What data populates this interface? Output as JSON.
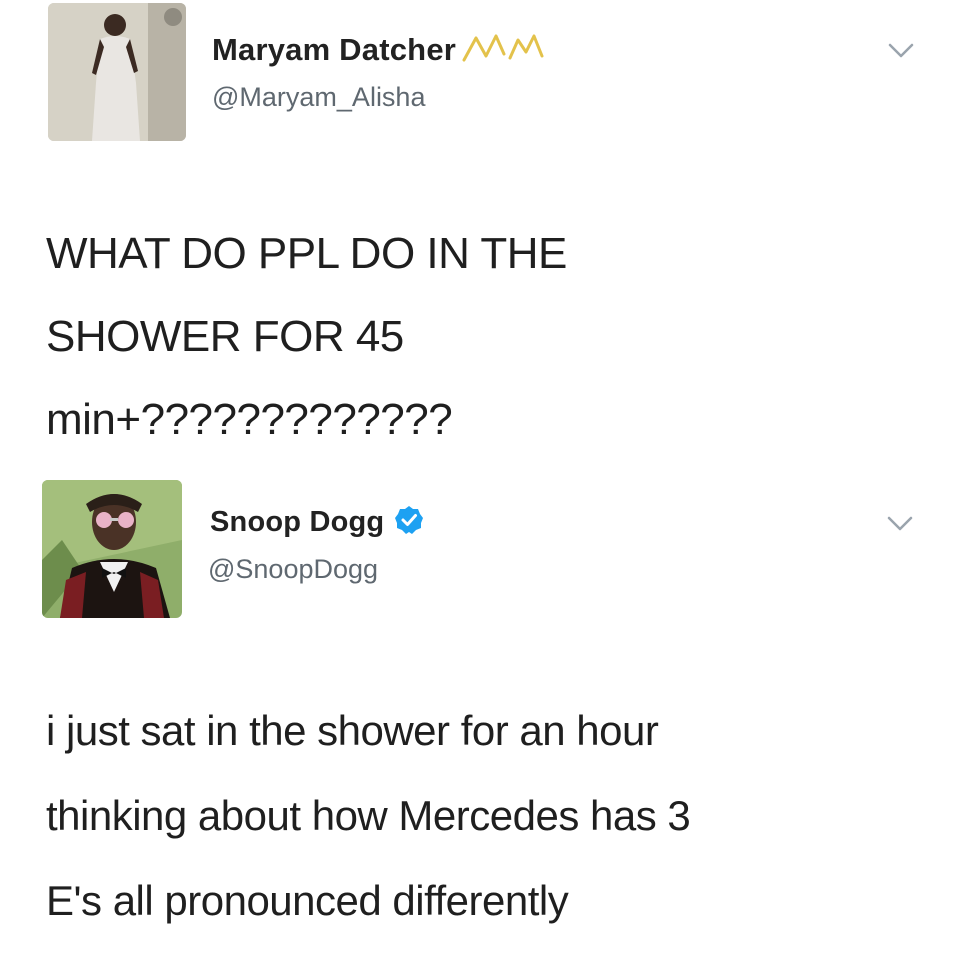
{
  "tweets": [
    {
      "author": {
        "display_name": "Maryam Datcher",
        "handle": "@Maryam_Alisha",
        "name_decoration_icon": "crown-doodle-icon",
        "avatar_icon": "person-photo-avatar"
      },
      "menu_icon": "chevron-down-icon",
      "text_lines": [
        "WHAT DO PPL DO IN THE",
        "SHOWER FOR 45",
        "min+?????????????"
      ]
    },
    {
      "author": {
        "display_name": "Snoop Dogg",
        "handle": "@SnoopDogg",
        "verified": true,
        "verified_icon": "verified-badge-icon",
        "avatar_icon": "snoop-portrait-avatar"
      },
      "menu_icon": "chevron-down-icon",
      "text_lines": [
        "i just sat in the shower for an hour",
        "thinking about how Mercedes has 3",
        "E's all pronounced differently"
      ]
    }
  ],
  "colors": {
    "background": "#ffffff",
    "text": "#1f1f1f",
    "handle": "#5f6870",
    "verified": "#1da1f2",
    "crown_doodle": "#e3c24b",
    "chevron": "#9aa4ad"
  }
}
